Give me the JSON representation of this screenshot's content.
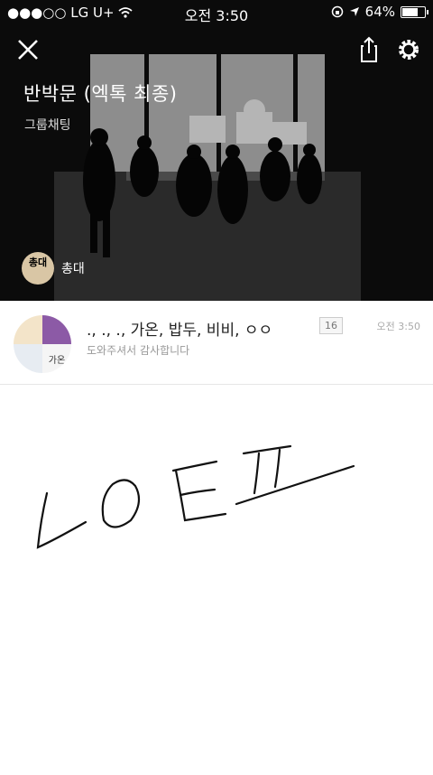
{
  "status_bar": {
    "carrier": "●●●○○ LG U+",
    "time": "오전 3:50",
    "battery": "64%",
    "battery_level": 0.64
  },
  "header": {
    "title": "반박문 (엑톡 최종)",
    "subtitle": "그룹채팅",
    "owner_avatar_text": "총대",
    "owner_name": "총대"
  },
  "message": {
    "participants": "., ., ., 가온, 밥두, 비비, ㅇㅇ",
    "count": "16",
    "time": "오전 3:50",
    "preview": "도와주셔서 감사합니다",
    "avatar_label": "가온"
  },
  "drawing": {
    "strokes_label": "LOEI"
  }
}
